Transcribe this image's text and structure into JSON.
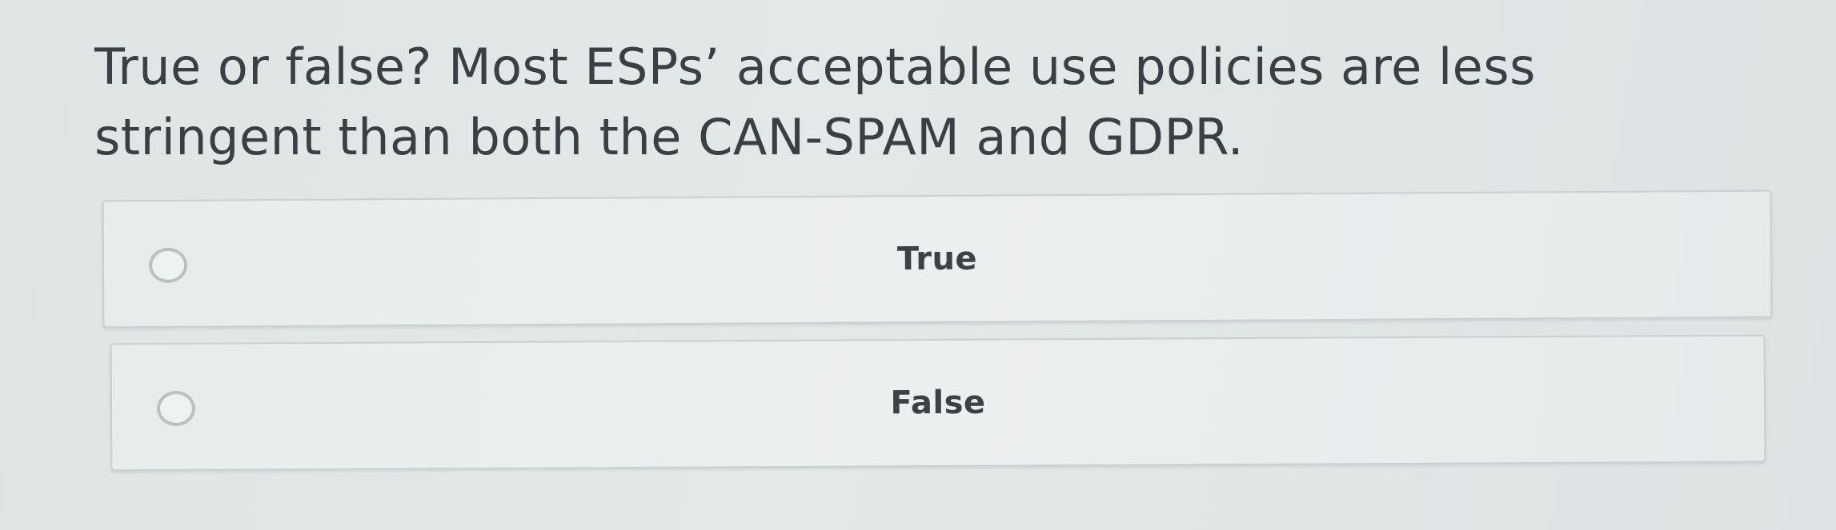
{
  "question": {
    "text": "True or false? Most ESPs’ acceptable use policies are less stringent than both the CAN-SPAM and GDPR."
  },
  "options": [
    {
      "label": "True",
      "selected": false
    },
    {
      "label": "False",
      "selected": false
    }
  ],
  "colors": {
    "background": "#e1e6e6",
    "option_background": "#eaeeee",
    "option_border": "#c9d0d2",
    "radio_border": "#b9c1c3",
    "text": "#3b3f43"
  },
  "icons": {
    "radio": "radio-unchecked-icon"
  }
}
